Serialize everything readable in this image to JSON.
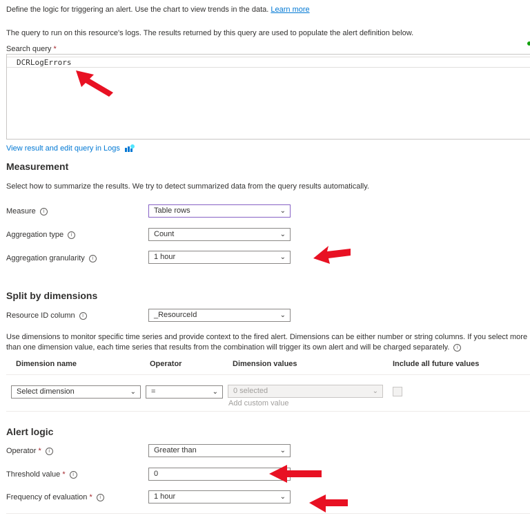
{
  "intro": {
    "text": "Define the logic for triggering an alert. Use the chart to view trends in the data.",
    "learn_more": "Learn more"
  },
  "query": {
    "description": "The query to run on this resource's logs. The results returned by this query are used to populate the alert definition below.",
    "label": "Search query",
    "required_mark": "*",
    "value": "DCRLogErrors",
    "view_link": "View result and edit query in Logs"
  },
  "measurement": {
    "heading": "Measurement",
    "description": "Select how to summarize the results. We try to detect summarized data from the query results automatically.",
    "measure": {
      "label": "Measure",
      "value": "Table rows"
    },
    "aggregation_type": {
      "label": "Aggregation type",
      "value": "Count"
    },
    "aggregation_granularity": {
      "label": "Aggregation granularity",
      "value": "1 hour"
    }
  },
  "split": {
    "heading": "Split by dimensions",
    "resource_id": {
      "label": "Resource ID column",
      "value": "_ResourceId"
    },
    "description_line1": "Use dimensions to monitor specific time series and provide context to the fired alert. Dimensions can be either number or string columns. If you select more",
    "description_line2": "than one dimension value, each time series that results from the combination will trigger its own alert and will be charged separately.",
    "columns": {
      "dimension_name": "Dimension name",
      "operator": "Operator",
      "dimension_values": "Dimension values",
      "include_future": "Include all future values"
    },
    "row": {
      "dimension": "Select dimension",
      "operator": "=",
      "values": "0 selected",
      "add_custom": "Add custom value"
    }
  },
  "alert_logic": {
    "heading": "Alert logic",
    "operator": {
      "label": "Operator",
      "value": "Greater than"
    },
    "threshold": {
      "label": "Threshold value",
      "value": "0"
    },
    "frequency": {
      "label": "Frequency of evaluation",
      "value": "1 hour"
    },
    "required_mark": "*"
  },
  "icons": {
    "info": "ⓘ",
    "chevron": "⌵",
    "info_glyph": "i"
  },
  "colors": {
    "link": "#0078d4",
    "arrow": "#e81123",
    "focus_border": "#8661c5",
    "status_dot": "#13a10e"
  }
}
